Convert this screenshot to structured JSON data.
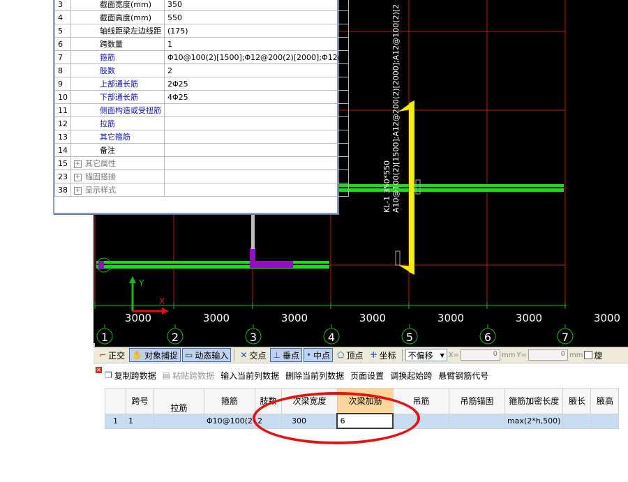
{
  "properties": {
    "rows": [
      {
        "num": "3",
        "name": "截面宽度(mm)",
        "value": "350",
        "style": "normal"
      },
      {
        "num": "4",
        "name": "截面高度(mm)",
        "value": "550",
        "style": "normal"
      },
      {
        "num": "5",
        "name": "轴线距梁左边线距",
        "value": "(175)",
        "style": "normal"
      },
      {
        "num": "6",
        "name": "跨数量",
        "value": "1",
        "style": "normal"
      },
      {
        "num": "7",
        "name": "箍筋",
        "value": "Φ10@100(2)[1500];Φ12@200(2)[2000];Φ12@",
        "style": "blue"
      },
      {
        "num": "8",
        "name": "肢数",
        "value": "2",
        "style": "blue"
      },
      {
        "num": "9",
        "name": "上部通长筋",
        "value": "2Φ25",
        "style": "blue"
      },
      {
        "num": "10",
        "name": "下部通长筋",
        "value": "4Φ25",
        "style": "blue"
      },
      {
        "num": "11",
        "name": "侧面构造或受扭筋",
        "value": "",
        "style": "blue"
      },
      {
        "num": "12",
        "name": "拉筋",
        "value": "",
        "style": "blue"
      },
      {
        "num": "13",
        "name": "其它箍筋",
        "value": "",
        "style": "blue"
      },
      {
        "num": "14",
        "name": "备注",
        "value": "",
        "style": "normal"
      },
      {
        "num": "15",
        "name": "其它属性",
        "value": "",
        "style": "gray",
        "expand": "+"
      },
      {
        "num": "23",
        "name": "锚固搭接",
        "value": "",
        "style": "gray",
        "expand": "+"
      },
      {
        "num": "38",
        "name": "显示样式",
        "value": "",
        "style": "gray",
        "expand": "+"
      }
    ]
  },
  "cad": {
    "dims": [
      "3000",
      "3000",
      "3000",
      "3000",
      "3000",
      "3000",
      "3000"
    ],
    "axes": [
      "1",
      "2",
      "3",
      "4",
      "5",
      "6",
      "7"
    ],
    "beam_label_1": "KL-1 350*550",
    "beam_label_2": "A10@100(2)[1500];A12@200(2)[2000];A12@100(2)[2",
    "ucs_x": "X",
    "ucs_y": "Y",
    "colors": {
      "grid": "#e01010",
      "beam": "#18e018",
      "selected": "#f0f000",
      "axis": "#10c010",
      "ucs_y": "#10c010",
      "ucs_x": "#e01010"
    }
  },
  "snapbar": {
    "ortho": "正交",
    "object_snap": "对象捕捉",
    "dynamic_input": "动态输入",
    "intersection": "交点",
    "perpendicular": "垂点",
    "midpoint": "中点",
    "vertex": "顶点",
    "coordinate": "坐标",
    "offset_mode": "不偏移",
    "x_label": "X=",
    "x_value": "0",
    "y_label": "Y=",
    "y_value": "0",
    "unit": "mm",
    "rotate": "旋"
  },
  "bottom": {
    "ops": {
      "copy_span": "复制跨数据",
      "paste_span": "粘贴跨数据",
      "input_column": "输入当前列数据",
      "delete_column": "删除当前列数据",
      "page_setup": "页面设置",
      "swap_start": "调换起始跨",
      "cantilever": "悬臂钢筋代号"
    },
    "headers": {
      "span_no": "跨号",
      "tie_bar": "拉筋",
      "stirrup": "箍筋",
      "legs": "肢数",
      "sec_beam_width": "次梁宽度",
      "sec_beam_add": "次梁加筋",
      "hanger": "吊筋",
      "hanger_anchor": "吊筋锚固",
      "densify_len": "箍筋加密长度",
      "haunch_len": "腋长",
      "haunch_h": "腋高"
    },
    "row": {
      "row_num": "1",
      "span_no": "1",
      "tie_bar": "",
      "stirrup": "Φ10@100(2",
      "legs": "2",
      "sec_beam_width": "300",
      "sec_beam_add": "6",
      "hanger": "",
      "hanger_anchor": "",
      "densify_len": "max(2*h,500)",
      "haunch_len": "",
      "haunch_h": ""
    }
  }
}
